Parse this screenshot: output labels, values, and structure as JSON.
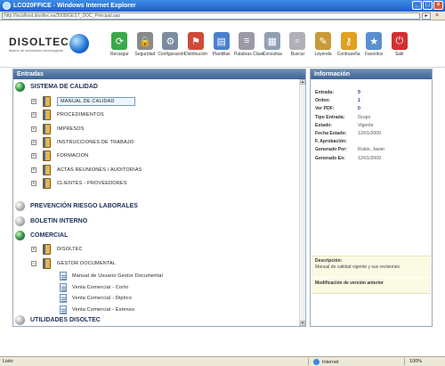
{
  "window": {
    "title": "LCO20FFICE - Windows Internet Explorer",
    "address": "http://localhost.disoltec.es/2008/GEST_DOC_Principal.asp"
  },
  "app": {
    "logo_text": "DISOLTEC",
    "logo_subtext": "diseño de soluciones tecnológicas"
  },
  "toolbar": [
    {
      "label": "Recargar",
      "icon": "refresh-icon",
      "color": "#3aa84a",
      "glyph": "⟳"
    },
    {
      "label": "Seguridad",
      "icon": "lock-icon",
      "color": "#8a8a8a",
      "glyph": "🔒"
    },
    {
      "label": "Configuración",
      "icon": "printer-icon",
      "color": "#7a8ca0",
      "glyph": "⚙"
    },
    {
      "label": "Distribución",
      "icon": "distribution-icon",
      "color": "#d04a3a",
      "glyph": "⚑"
    },
    {
      "label": "Plantillas",
      "icon": "templates-icon",
      "color": "#4a7fd0",
      "glyph": "▤"
    },
    {
      "label": "Palabras Clave",
      "icon": "keywords-icon",
      "color": "#9a9aa8",
      "glyph": "≡"
    },
    {
      "label": "Consultas",
      "icon": "queries-icon",
      "color": "#8fa0b5",
      "glyph": "▦"
    },
    {
      "label": "Buscar",
      "icon": "search-icon",
      "color": "#b0b0b8",
      "glyph": "⌕"
    },
    {
      "label": "Leyenda",
      "icon": "legend-icon",
      "color": "#c89a3a",
      "glyph": "✎"
    },
    {
      "label": "Contraseña",
      "icon": "key-icon",
      "color": "#e0a020",
      "glyph": "⚷"
    },
    {
      "label": "Favoritos",
      "icon": "favorites-icon",
      "color": "#5a8fcf",
      "glyph": "★"
    },
    {
      "label": "Salir",
      "icon": "exit-icon",
      "color": "#d23030",
      "glyph": "⏻"
    }
  ],
  "left_panel": {
    "title": "Entradas",
    "tree": {
      "sistema_calidad": "SISTEMA DE CALIDAD",
      "sistema_children": [
        "MANUAL DE CALIDAD",
        "PROCEDIMIENTOS",
        "IMPRESOS",
        "INSTRUCCIONES DE TRABAJO",
        "FORMACION",
        "ACTAS REUNIONES / AUDITORIAS",
        "CLIENTES - PROVEEDORES"
      ],
      "prevencion": "PREVENCIÓN RIESGO LABORALES",
      "boletin": "BOLETIN INTERNO",
      "comercial": "COMERCIAL",
      "comercial_children": [
        "DISOLTEC",
        "GESTOR DOCUMENTAL"
      ],
      "gestor_docs": [
        "Manual de Usuario Gestor Documental",
        "Venta Comercial - Corto",
        "Venta Comercial - Diptico",
        "Venta Comercial - Extenso"
      ],
      "utilidades": "UTILIDADES DISOLTEC"
    }
  },
  "right_panel": {
    "title": "Información",
    "rows": [
      {
        "key": "Entrada:",
        "value": "9"
      },
      {
        "key": "Orden:",
        "value": "1"
      },
      {
        "key": "Ver PDF:",
        "value": "0"
      },
      {
        "key": "Tipo Entrada:",
        "value": "Grupo"
      },
      {
        "key": "Estado:",
        "value": "Vigente"
      },
      {
        "key": "Fecha Estado:",
        "value": "12/01/2009"
      },
      {
        "key": "F. Aprobación:",
        "value": ""
      },
      {
        "key": "Generado Por:",
        "value": "Rubio, Javier"
      },
      {
        "key": "Generado En:",
        "value": "12/01/2009"
      }
    ],
    "description_title": "Descripción:",
    "description_text": "Manual de calidad vigente y sus revisiones",
    "modification_title": "Modificación de versión anterior"
  },
  "statusbar": {
    "left": "Listo",
    "zone": "Internet",
    "zoom": "100%"
  }
}
